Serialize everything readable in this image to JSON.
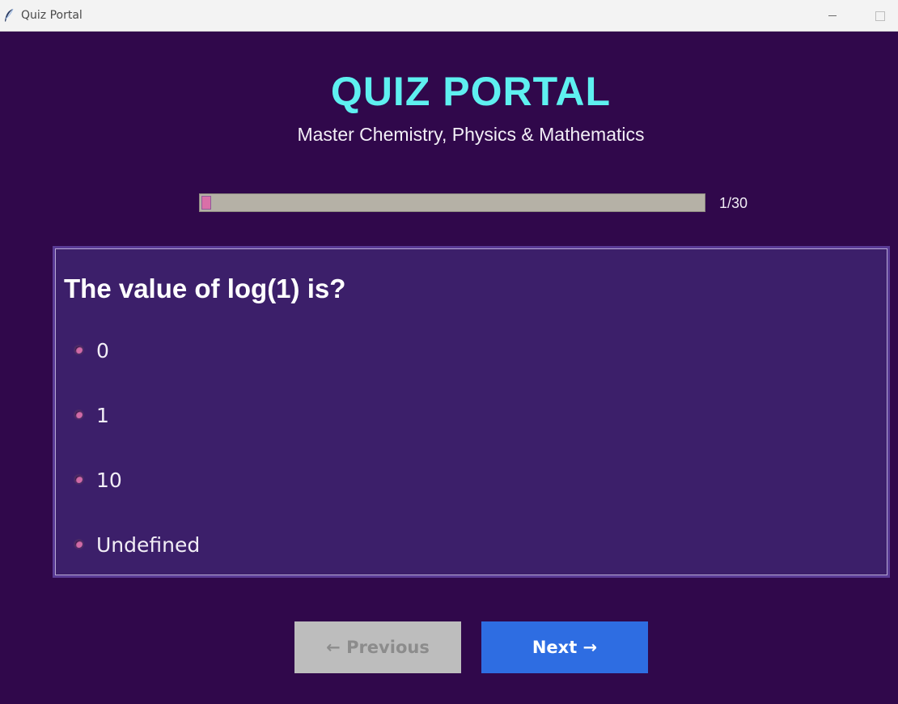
{
  "window": {
    "title": "Quiz Portal",
    "icon": "feather-icon"
  },
  "header": {
    "title": "QUIZ PORTAL",
    "subtitle": "Master Chemistry, Physics & Mathematics"
  },
  "progress": {
    "label": "1/30",
    "current": 1,
    "total": 30
  },
  "question": {
    "text": "The value of log(1) is?",
    "options": [
      {
        "label": "0"
      },
      {
        "label": "1"
      },
      {
        "label": "10"
      },
      {
        "label": "Undefined"
      }
    ]
  },
  "navigation": {
    "previous_label": "← Previous",
    "next_label": "Next →"
  },
  "colors": {
    "background": "#30084b",
    "card": "#3c1f6a",
    "title": "#5ef0f0",
    "progress_fill": "#d96fa8",
    "next_button": "#2e6de2",
    "previous_button_disabled": "#bdbdbd"
  }
}
